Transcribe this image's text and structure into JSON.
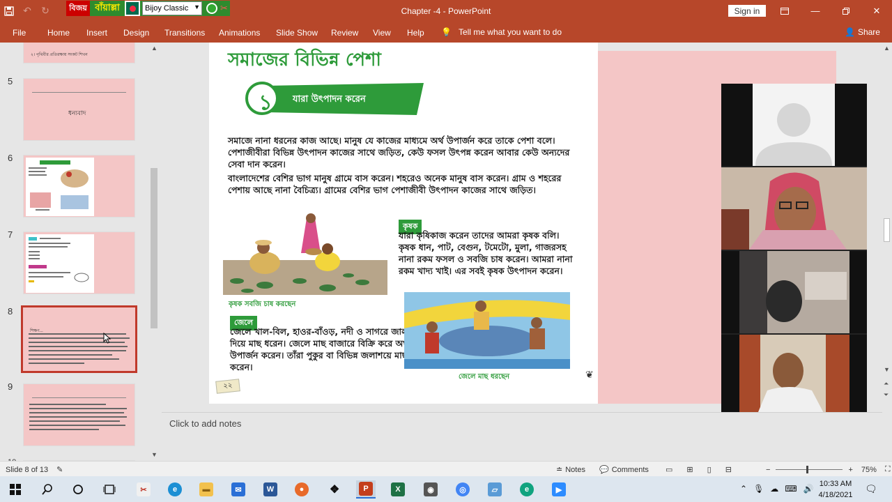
{
  "window": {
    "title": "Chapter -4  -  PowerPoint",
    "sign_in": "Sign in",
    "bijoy": {
      "badge": "বিজয়",
      "app_name": "বাঁয়াল্লা",
      "keyboard_layout": "Bijoy Classic"
    }
  },
  "ribbon": {
    "tabs": [
      "File",
      "Home",
      "Insert",
      "Design",
      "Transitions",
      "Animations",
      "Slide Show",
      "Review",
      "View",
      "Help"
    ],
    "tell_me": "Tell me what you want to do",
    "share": "Share"
  },
  "thumbnails": {
    "items": [
      {
        "num": "5",
        "text": "ধন্যবাদ"
      },
      {
        "num": "6"
      },
      {
        "num": "7"
      },
      {
        "num": "8",
        "text": "শিক্ষণ..."
      },
      {
        "num": "9"
      }
    ],
    "partial_top_text": "২। পৃথিবীর প্রতিরক্ষায় সংকট শিখন",
    "partial_bottom_num": "10"
  },
  "slide": {
    "heading": "সমাজের বিভিন্ন পেশা",
    "banner_number": "১",
    "banner_text": "যারা উৎপাদন করেন",
    "para1": "সমাজে নানা ধরনের কাজ আছে। মানুষ যে কাজের মাধ্যমে অর্থ উপার্জন করে তাকে পেশা বলে। পেশাজীবীরা বিভিন্ন উৎপাদন কাজের সাথে জড়িত, কেউ ফসল উৎপন্ন করেন আবার কেউ অন্যদের সেবা দান করেন।",
    "para2": "বাংলাদেশের বেশির ভাগ মানুষ গ্রামে বাস করেন। শহরেও অনেক মানুষ বাস করেন। গ্রাম ও শহরের পেশায় আছে নানা বৈচিত্র্য। গ্রামের বেশির ভাগ পেশাজীবী উৎপাদন কাজের সাথে জড়িত।",
    "farmer_label": "কৃষক",
    "farmer_text": "যারা কৃষিকাজ করেন তাদের আমরা কৃষক বলি। কৃষক ধান, পাট, বেগুন, টমেটো, মুলা, গাজরসহ নানা রকম ফসল ও সবজি চাষ করেন। আমরা নানা রকম খাদ্য খাই। এর সবই কৃষক উৎপাদন করেন।",
    "farmer_caption": "কৃষক সবজি চাষ করছেন",
    "fisher_label": "জেলে",
    "fisher_text": "জেলে খাল-বিল, হাওর-বাঁওড়, নদী ও সাগরে জাল দিয়ে মাছ ধরেন। জেলে মাছ বাজারে বিক্রি করে অর্থ উপার্জন করেন। তাঁরা পুকুর বা বিভিন্ন জলাশয়ে মাছ চাষ করেন।",
    "fisher_caption": "জেলে মাছ ধরছেন",
    "page_number": "২২"
  },
  "notes": {
    "placeholder": "Click to add notes"
  },
  "status": {
    "slide_info": "Slide 8 of 13",
    "notes": "Notes",
    "comments": "Comments",
    "zoom": "75%"
  },
  "taskbar": {
    "time": "10:33 AM",
    "date": "4/18/2021",
    "apps": [
      "start",
      "search",
      "cortana",
      "task-view",
      "snipping",
      "edge",
      "explorer",
      "mail",
      "word",
      "firefox",
      "dropbox",
      "powerpoint",
      "excel",
      "camera",
      "chrome",
      "whiteboard",
      "evernote",
      "zoom"
    ]
  },
  "colors": {
    "accent": "#b7472a",
    "slide_pink": "#f4c6c6",
    "heading_green": "#2e9b3a"
  }
}
